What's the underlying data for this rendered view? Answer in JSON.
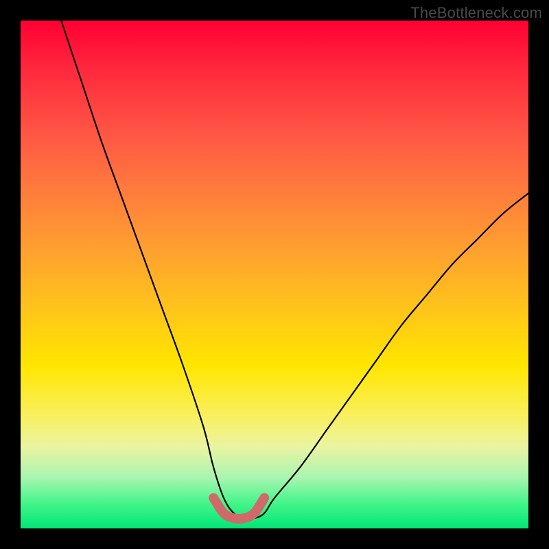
{
  "watermark": "TheBottleneck.com",
  "chart_data": {
    "type": "line",
    "title": "",
    "xlabel": "",
    "ylabel": "",
    "xlim": [
      0,
      100
    ],
    "ylim": [
      0,
      100
    ],
    "series": [
      {
        "name": "bottleneck-curve",
        "x": [
          8,
          12,
          16,
          20,
          24,
          28,
          32,
          36,
          38,
          40,
          42,
          44,
          46,
          48,
          50,
          55,
          60,
          65,
          70,
          75,
          80,
          85,
          90,
          95,
          100
        ],
        "y": [
          100,
          88,
          76,
          65,
          54,
          43,
          32,
          20,
          12,
          6,
          3,
          2,
          2,
          3,
          6,
          12,
          19,
          26,
          33,
          40,
          46,
          52,
          57,
          62,
          66
        ]
      },
      {
        "name": "optimal-highlight",
        "x": [
          38,
          40,
          42,
          44,
          46,
          48
        ],
        "y": [
          6,
          3,
          2,
          2,
          3,
          6
        ]
      }
    ],
    "annotations": []
  },
  "colors": {
    "curve": "#000000",
    "highlight": "#d06a6a",
    "background_top": "#ff0033",
    "background_bottom": "#00e676",
    "frame": "#000000"
  }
}
